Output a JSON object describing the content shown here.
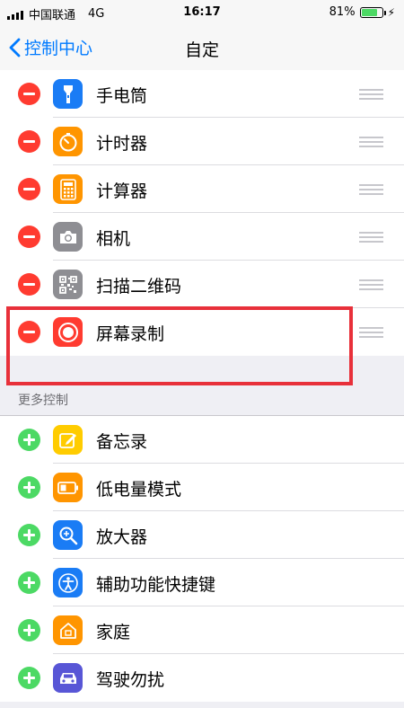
{
  "status_bar": {
    "carrier": "中国联通",
    "network": "4G",
    "time": "16:17",
    "battery_percent": "81%",
    "battery_level": 0.81
  },
  "nav": {
    "back_label": "控制中心",
    "title": "自定"
  },
  "included": [
    {
      "label": "手电筒",
      "icon": "flashlight-icon",
      "color": "#1a7cf5"
    },
    {
      "label": "计时器",
      "icon": "timer-icon",
      "color": "#ff9500"
    },
    {
      "label": "计算器",
      "icon": "calculator-icon",
      "color": "#ff9500"
    },
    {
      "label": "相机",
      "icon": "camera-icon",
      "color": "#8e8e93"
    },
    {
      "label": "扫描二维码",
      "icon": "qr-code-icon",
      "color": "#8e8e93"
    },
    {
      "label": "屏幕录制",
      "icon": "screen-record-icon",
      "color": "#ff3b30"
    }
  ],
  "more": {
    "header": "更多控制",
    "items": [
      {
        "label": "备忘录",
        "icon": "notes-icon",
        "color": "#ffcc00"
      },
      {
        "label": "低电量模式",
        "icon": "low-power-icon",
        "color": "#ff9500"
      },
      {
        "label": "放大器",
        "icon": "magnifier-icon",
        "color": "#1a7cf5"
      },
      {
        "label": "辅助功能快捷键",
        "icon": "accessibility-icon",
        "color": "#1a7cf5"
      },
      {
        "label": "家庭",
        "icon": "home-icon",
        "color": "#ff9500"
      },
      {
        "label": "驾驶勿扰",
        "icon": "car-icon",
        "color": "#5856d6"
      }
    ]
  }
}
